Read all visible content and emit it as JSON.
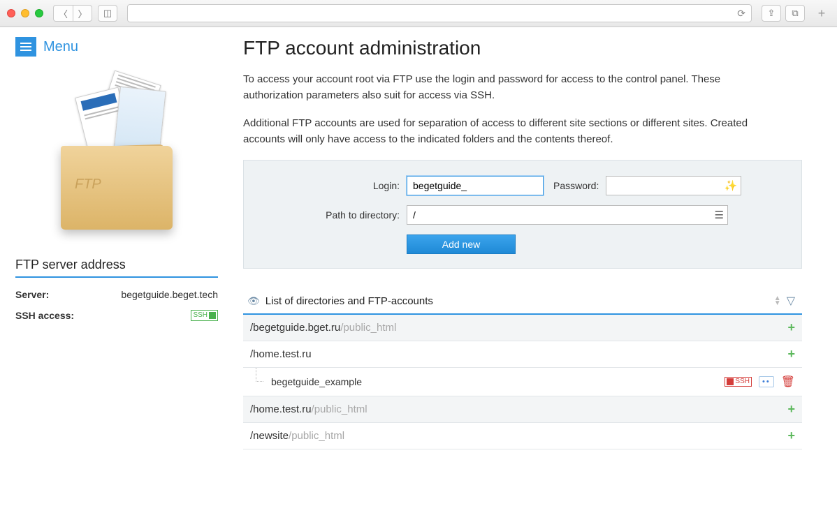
{
  "browser": {
    "reload_glyph": "⟳",
    "share_glyph": "⇪",
    "tabs_glyph": "⧉",
    "plus_glyph": "+"
  },
  "menu": {
    "label": "Menu"
  },
  "sidebar": {
    "heading": "FTP server address",
    "server_label": "Server:",
    "server_value": "begetguide.beget.tech",
    "ssh_label": "SSH access:",
    "ssh_badge": "SSH"
  },
  "page_title": "FTP account administration",
  "desc1": "To access your account root via FTP use the login and password for access to the control panel. These authorization parameters also suit for access via SSH.",
  "desc2": "Additional FTP accounts are used for separation of access to different site sections or different sites. Created accounts will only have access to the indicated folders and the contents thereof.",
  "form": {
    "login_label": "Login:",
    "login_value": "begetguide_",
    "password_label": "Password:",
    "password_value": "",
    "path_label": "Path to directory:",
    "path_value": "/",
    "add_button": "Add new"
  },
  "list": {
    "heading": "List of directories and FTP-accounts",
    "rows": [
      {
        "path": "/begetguide.bget.ru",
        "suffix": "/public_html"
      },
      {
        "path": "/home.test.ru",
        "suffix": ""
      },
      {
        "path": "/home.test.ru",
        "suffix": "/public_html"
      },
      {
        "path": "/newsite",
        "suffix": "/public_html"
      }
    ],
    "account_name": "begetguide_example",
    "ssh_badge": "SSH"
  }
}
